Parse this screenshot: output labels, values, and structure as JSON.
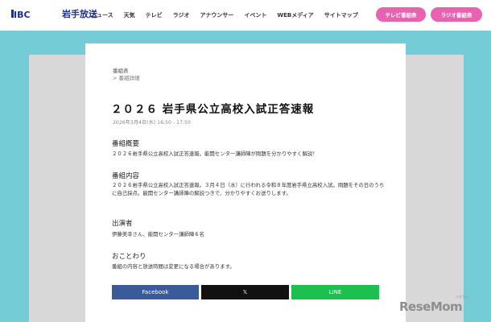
{
  "header": {
    "logo_text": "岩手放送",
    "nav": [
      "ニュース",
      "天気",
      "テレビ",
      "ラジオ",
      "アナウンサー",
      "イベント",
      "WEBメディア",
      "サイトマップ"
    ],
    "tv_guide_button": "テレビ番組表",
    "radio_guide_button": "ラジオ番組表"
  },
  "breadcrumb": {
    "parent": "番組表",
    "current": "> 番組詳細"
  },
  "program": {
    "title": "２０２６ 岩手県公立高校入試正答速報",
    "airtime": "2026年3月4日(水) 16:50 - 17:50",
    "sections": [
      {
        "heading": "番組概要",
        "text": "２０２６岩手県公立高校入試正答速報。能開センター講師陣が問題を分かりやすく解説！"
      },
      {
        "heading": "番組内容",
        "text": "２０２６岩手県公立高校入試正答速報。３月４日（水）に行われる令和８年度岩手県立高校入試。問題をその日のうちに自己採点。能開センター講師陣の解説つきで、分かりやすくお送りします。"
      },
      {
        "heading": "出演者",
        "text": "伊藤美幸さん、能開センター講師陣６名"
      },
      {
        "heading": "おことわり",
        "text": "番組の内容と放送時間は変更になる場合があります。"
      }
    ]
  },
  "share": {
    "facebook": "Facebook",
    "x": "𝕏",
    "line": "LINE"
  },
  "watermark": {
    "text": "ReseMom",
    "small": "リセマム"
  },
  "colors": {
    "band": "#74cdd6",
    "pill": "#e763b0",
    "facebook": "#3b5a9a",
    "x": "#111111",
    "line": "#1dc04f",
    "logo": "#1d2f8c"
  }
}
